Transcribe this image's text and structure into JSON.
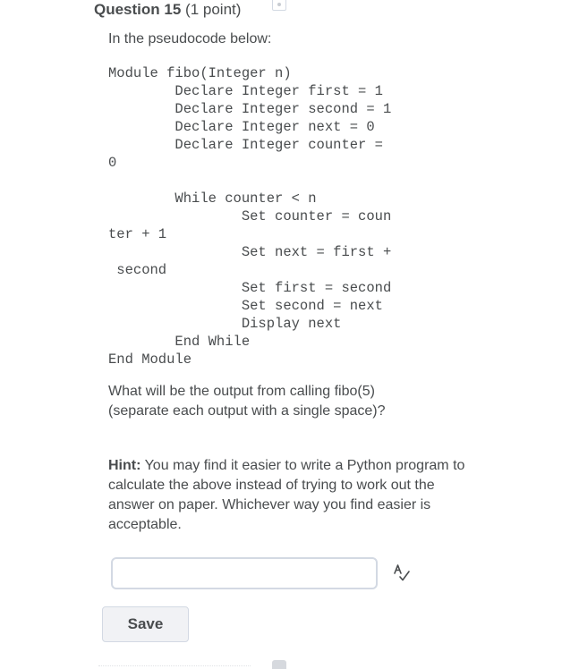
{
  "question": {
    "title": "Question 15",
    "points": "(1 point)",
    "intro": "In the pseudocode below:",
    "code_lines": [
      "Module fibo(Integer n)",
      "        Declare Integer first = 1",
      "        Declare Integer second = 1",
      "        Declare Integer next = 0",
      "        Declare Integer counter =",
      "0",
      "",
      "        While counter < n",
      "                Set counter = coun",
      "ter + 1",
      "                Set next = first +",
      " second",
      "                Set first = second",
      "                Set second = next",
      "                Display next",
      "        End While",
      "End Module"
    ],
    "prompt_line1": "What will be the output from calling fibo(5)",
    "prompt_line2": "(separate each output with a single space)?",
    "hint_label": "Hint:",
    "hint_text": " You may find it easier to write a Python program to calculate the above instead of trying to work out the answer on paper. Whichever way you find easier is acceptable."
  },
  "answer": {
    "value": "",
    "placeholder": ""
  },
  "icons": {
    "flag": "flag-icon",
    "spellcheck": "spellcheck-icon"
  },
  "actions": {
    "save_label": "Save"
  }
}
